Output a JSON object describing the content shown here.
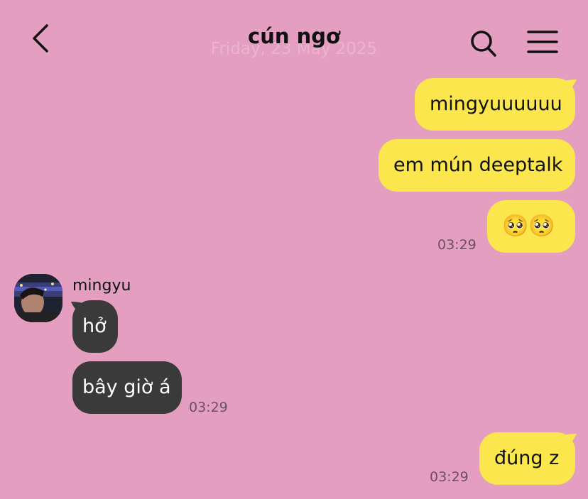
{
  "header": {
    "title": "cún ngơ",
    "date_separator": "Friday, 23 May 2025"
  },
  "messages": [
    {
      "sender": "me",
      "text": "mingyuuuuuu"
    },
    {
      "sender": "me",
      "text": "em mún deeptalk"
    },
    {
      "sender": "me",
      "text": "🥺🥺",
      "time": "03:29"
    },
    {
      "sender": "them",
      "name": "mingyu",
      "text": "hở"
    },
    {
      "sender": "them",
      "text": "bây giờ á",
      "time": "03:29"
    },
    {
      "sender": "me",
      "text": "đúng z",
      "time": "03:29"
    }
  ],
  "colors": {
    "background": "#e49fc0",
    "my_bubble": "#fbe64d",
    "their_bubble": "#3b3a3b"
  },
  "icons": [
    "back-icon",
    "search-icon",
    "menu-icon",
    "avatar"
  ]
}
